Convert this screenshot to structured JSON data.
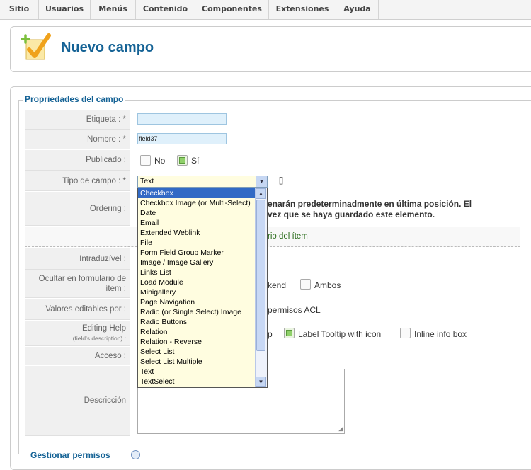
{
  "menu": {
    "items": [
      "Sitio",
      "Usuarios",
      "Menús",
      "Contenido",
      "Componentes",
      "Extensiones",
      "Ayuda"
    ]
  },
  "header": {
    "title": "Nuevo campo",
    "icon": "new-field-checkmark-icon"
  },
  "form": {
    "legend": "Propriedades del campo",
    "labels": {
      "etiqueta": "Etiqueta  : *",
      "nombre": "Nombre  : *",
      "publicado": "Publicado  :",
      "tipo": "Tipo de campo  : *",
      "ordering": "Ordering  :",
      "intraduzivel": "Intraduzível  :",
      "ocultar_line1": "Ocultar en formulario de",
      "ocultar_line2": "ítem  :",
      "valores": "Valores editables por  :",
      "editing_help": "Editing Help",
      "editing_help_sub": "(field's description)  :",
      "acceso": "Acceso  :",
      "descripcion": "Descricción"
    },
    "etiqueta_value": "",
    "nombre_value": "field37",
    "publicado": {
      "no": "No",
      "si": "Sí",
      "selected": "si"
    },
    "tipo_selected": "Text",
    "tipo_bracket": "[]",
    "ordering_note_line1": "enarán predeterminadmente en última posición. El",
    "ordering_note_line2": "vez que se haya guardado este elemento.",
    "green_note": "rio del ítem",
    "ocultar_options": {
      "kend": "kend",
      "ambos": "Ambos"
    },
    "valores_text": "permisos ACL",
    "editing_help_options": {
      "p": "p",
      "tooltip_icon": "Label Tooltip with icon",
      "inline": "Inline info box"
    }
  },
  "dropdown": {
    "options": [
      "Checkbox",
      "Checkbox Image (or Multi-Select)",
      "Date",
      "Email",
      "Extended Weblink",
      "File",
      "Form Field Group Marker",
      "Image / Image Gallery",
      "Links List",
      "Load Module",
      "Minigallery",
      "Page Navigation",
      "Radio (or Single Select) Image",
      "Radio Buttons",
      "Relation",
      "Relation - Reverse",
      "Select List",
      "Select List Multiple",
      "Text",
      "TextSelect"
    ],
    "highlighted_index": 0
  },
  "bottom": {
    "link": "Gestionar permisos"
  },
  "colors": {
    "accent": "#146295",
    "highlight": "#316ac5",
    "select_bg": "#fffde0"
  }
}
